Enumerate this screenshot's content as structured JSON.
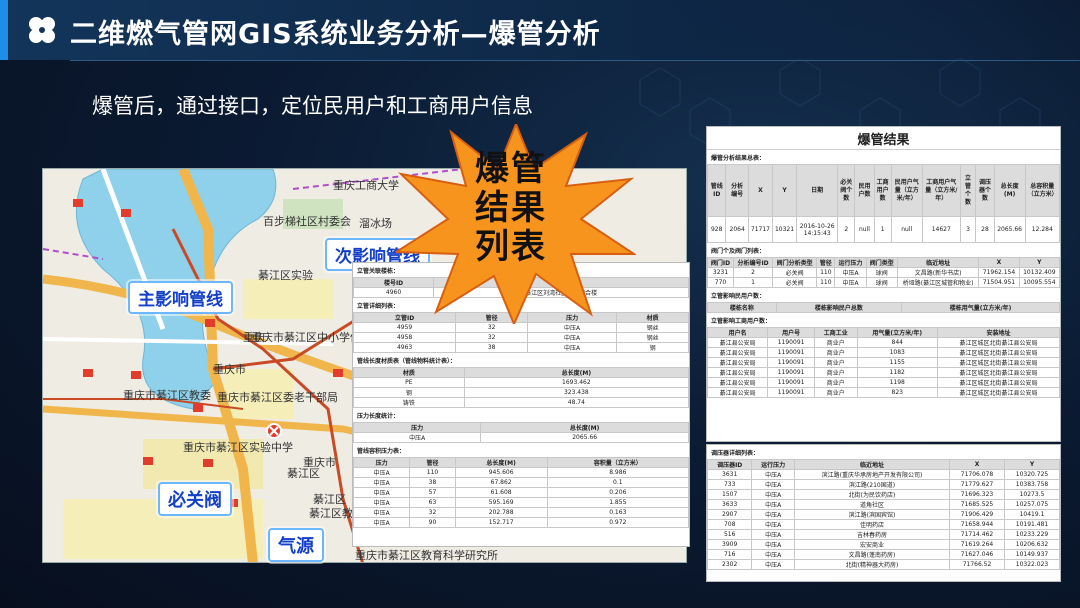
{
  "header": {
    "title": "二维燃气管网GIS系统业务分析—爆管分析",
    "subtitle": "爆管后，通过接口，定位民用户和工商用户信息",
    "accent_color": "#1d8fe8"
  },
  "map": {
    "labels": [
      "重庆工商大学",
      "百步梯社区村委会",
      "溜冰场",
      "綦江区实验",
      "重庆市綦江区中小学体育基地",
      "重庆市綦江区教委",
      "重庆市綦江区委老干部局",
      "重庆市綦江区实验中学",
      "重庆市綦江区教育科学研究所",
      "重庆市",
      "重庆市",
      "綦江区",
      "綦江区",
      "綦江区教委",
      "重庆"
    ],
    "callouts": {
      "secondary": "次影响管线",
      "main": "主影响管线",
      "valve": "必关阀",
      "source": "气源"
    }
  },
  "starburst": {
    "lines": [
      "爆管",
      "结果",
      "列表"
    ]
  },
  "left_table": {
    "sec0": "立管关联楼栋：",
    "sec0_headers": [
      "楼号ID",
      "楼栋名"
    ],
    "sec0_rows": [
      [
        "4960",
        "綦江区刘湾社区北街综合楼"
      ]
    ],
    "sec1": "立管详细列表：",
    "sec1_headers": [
      "立管ID",
      "管径",
      "压力",
      "材质"
    ],
    "sec1_rows": [
      [
        "4959",
        "32",
        "中压A",
        "钢丝"
      ],
      [
        "4958",
        "32",
        "中压A",
        "钢丝"
      ],
      [
        "4963",
        "38",
        "中压A",
        "钢"
      ]
    ],
    "sec2": "管线长度材质表（管线物料统计表）：",
    "sec2_headers": [
      "材质",
      "总长度(M)"
    ],
    "sec2_rows": [
      [
        "PE",
        "1693.462"
      ],
      [
        "钢",
        "323.438"
      ],
      [
        "铸铁",
        "48.74"
      ]
    ],
    "sec3": "压力长度统计：",
    "sec3_headers": [
      "压力",
      "总长度(M)"
    ],
    "sec3_rows": [
      [
        "中压A",
        "2065.66"
      ]
    ],
    "sec4": "管线容积压力表：",
    "sec4_headers": [
      "压力",
      "管径",
      "总长度(M)",
      "容积量（立方米）"
    ],
    "sec4_rows": [
      [
        "中压A",
        "110",
        "945.606",
        "8.986"
      ],
      [
        "中压A",
        "38",
        "67.862",
        "0.1"
      ],
      [
        "中压A",
        "57",
        "61.608",
        "0.206"
      ],
      [
        "中压A",
        "63",
        "595.169",
        "1.855"
      ],
      [
        "中压A",
        "32",
        "202.788",
        "0.163"
      ],
      [
        "中压A",
        "90",
        "152.717",
        "0.972"
      ]
    ]
  },
  "right_table": {
    "title": "爆管结果",
    "sec0": "爆管分析结果总表：",
    "sec0_headers": [
      "管线ID",
      "分析编号",
      "X",
      "Y",
      "日期",
      "必关阀个数",
      "民用户数",
      "工商用户数",
      "民用户气量（立方米/年）",
      "工商用户气量（立方米/年）",
      "立管个数",
      "调压器个数",
      "总长度(M)",
      "总容积量（立方米）"
    ],
    "sec0_rows": [
      [
        "928",
        "2064",
        "71717",
        "10321",
        "2016-10-26 14:15:43",
        "2",
        "null",
        "1",
        "null",
        "14627",
        "3",
        "28",
        "2065.66",
        "12.284"
      ]
    ],
    "sec1": "阀门个及阀门列表：",
    "sec1_headers": [
      "阀门ID",
      "分析编号ID",
      "阀门分析类型",
      "管径",
      "运行压力",
      "阀门类型",
      "临近地址",
      "X",
      "Y"
    ],
    "sec1_rows": [
      [
        "3231",
        "2",
        "必关阀",
        "110",
        "中压A",
        "球阀",
        "文昌路(新华书店)",
        "71962.154",
        "10132.409"
      ],
      [
        "770",
        "1",
        "必关阀",
        "110",
        "中压A",
        "球阀",
        "桥垭路(綦江区城管和物业)",
        "71504.951",
        "10095.554"
      ]
    ],
    "sec2": "立管影响民用户数：",
    "sec2_headers": [
      "楼栋名称",
      "楼栋影响民户总数",
      "楼栋用气量(立方米/年)"
    ],
    "sec3": "立管影响工商用户数：",
    "sec3_headers": [
      "用户名",
      "用户号",
      "工商工业",
      "用气量(立方米/年)",
      "安装地址"
    ],
    "sec3_rows": [
      [
        "綦江县公安局",
        "1190091",
        "商业户",
        "844",
        "綦江区城区北街綦江县公安局"
      ],
      [
        "綦江县公安局",
        "1190091",
        "商业户",
        "1083",
        "綦江区城区北街綦江县公安局"
      ],
      [
        "綦江县公安局",
        "1190091",
        "商业户",
        "1155",
        "綦江区城区北街綦江县公安局"
      ],
      [
        "綦江县公安局",
        "1190091",
        "商业户",
        "1182",
        "綦江区城区北街綦江县公安局"
      ],
      [
        "綦江县公安局",
        "1190091",
        "商业户",
        "1198",
        "綦江区城区北街綦江县公安局"
      ],
      [
        "綦江县公安局",
        "1190091",
        "商业户",
        "823",
        "綦江区城区北街綦江县公安局"
      ]
    ],
    "sec4": "调压器详细列表：",
    "sec4_headers": [
      "调压器ID",
      "运行压力",
      "临近地址",
      "X",
      "Y"
    ],
    "sec4_rows": [
      [
        "3631",
        "中压A",
        "滨江路(重庆华承房地产开发有限公司)",
        "71706.078",
        "10320.725"
      ],
      [
        "733",
        "中压A",
        "滨江路(210国道)",
        "71779.627",
        "10383.758"
      ],
      [
        "1507",
        "中压A",
        "北街(为民饮药店)",
        "71696.323",
        "10273.5"
      ],
      [
        "3633",
        "中压A",
        "道角社区",
        "71685.525",
        "10257.075"
      ],
      [
        "2907",
        "中压A",
        "滨江路(滨国宾馆)",
        "71906.429",
        "10419.1"
      ],
      [
        "708",
        "中压A",
        "佳明药店",
        "71658.944",
        "10191.481"
      ],
      [
        "516",
        "中压A",
        "吉林春药房",
        "71714.462",
        "10233.229"
      ],
      [
        "3909",
        "中压A",
        "宏安商业",
        "71619.264",
        "10206.632"
      ],
      [
        "716",
        "中压A",
        "文昌路(蓬南药房)",
        "71627.046",
        "10149.937"
      ],
      [
        "2302",
        "中压A",
        "北街(精神器大药房)",
        "71766.52",
        "10322.023"
      ]
    ]
  }
}
